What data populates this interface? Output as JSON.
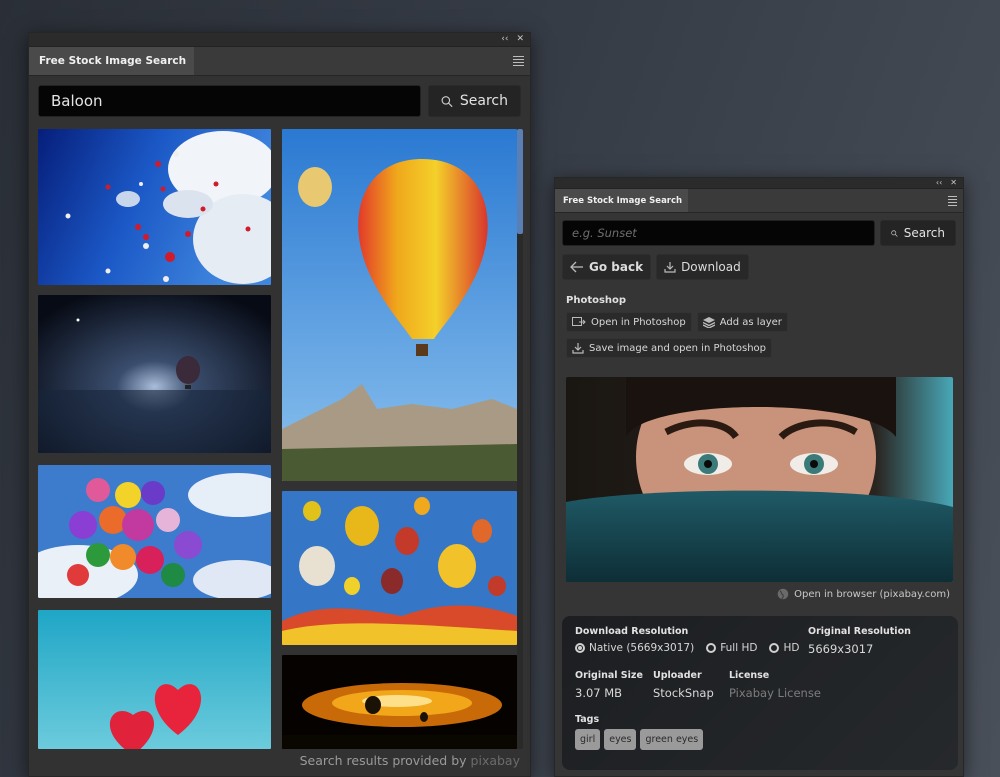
{
  "left_panel": {
    "tab_title": "Free Stock Image Search",
    "collapse_icon": "double-chevron-left-icon",
    "close_icon": "close-icon",
    "menu_icon": "hamburger-menu-icon",
    "search": {
      "value": "Baloon",
      "placeholder": "",
      "button_label": "Search"
    },
    "results": [
      {
        "subject": "red and white heart balloons in blue sky with clouds",
        "colors": [
          "#0a2a8c",
          "#1f5fc8",
          "#eef3fa"
        ]
      },
      {
        "subject": "hot air balloon over dark misty sea at night",
        "colors": [
          "#0a0f1a",
          "#2a3a55",
          "#9fb5d4"
        ]
      },
      {
        "subject": "bunch of colorful balloons in cloudy sky",
        "colors": [
          "#3b79c9",
          "#e8eef8",
          "#c23aa0"
        ]
      },
      {
        "subject": "red heart balloons against turquoise sky",
        "colors": [
          "#2aa9c9",
          "#5cc6da",
          "#e0223a"
        ]
      },
      {
        "subject": "striped hot air balloon over Cappadocia rocks",
        "colors": [
          "#2e7fd6",
          "#5aa6ea",
          "#f2b21f"
        ]
      },
      {
        "subject": "many hot air balloons in blue sky",
        "colors": [
          "#2f76c6",
          "#6aa8e0",
          "#e2682a"
        ]
      },
      {
        "subject": "balloons silhouetted in fiery sunset clouds",
        "colors": [
          "#0a0500",
          "#e88a10",
          "#2a1400"
        ]
      }
    ],
    "credit_text": "Search results provided by",
    "credit_brand": "pixabay"
  },
  "right_panel": {
    "tab_title": "Free Stock Image Search",
    "collapse_icon": "double-chevron-left-icon",
    "close_icon": "close-icon",
    "menu_icon": "hamburger-menu-icon",
    "search": {
      "value": "",
      "placeholder": "e.g. Sunset",
      "button_label": "Search"
    },
    "go_back_label": "Go back",
    "download_label": "Download",
    "photoshop": {
      "section_title": "Photoshop",
      "open_label": "Open in Photoshop",
      "add_layer_label": "Add as layer",
      "save_open_label": "Save image and open in Photoshop"
    },
    "preview_subject": "woman with green eyes covering face with teal scarf",
    "open_browser_label": "Open in browser (pixabay.com)",
    "details": {
      "download_resolution_label": "Download Resolution",
      "resolution_options": [
        {
          "label": "Native (5669x3017)",
          "selected": true
        },
        {
          "label": "Full HD",
          "selected": false
        },
        {
          "label": "HD",
          "selected": false
        }
      ],
      "original_resolution_label": "Original Resolution",
      "original_resolution_value": "5669x3017",
      "original_size_label": "Original Size",
      "original_size_value": "3.07 MB",
      "uploader_label": "Uploader",
      "uploader_value": "StockSnap",
      "license_label": "License",
      "license_value": "Pixabay License",
      "tags_label": "Tags",
      "tags": [
        "girl",
        "eyes",
        "green eyes"
      ]
    }
  }
}
